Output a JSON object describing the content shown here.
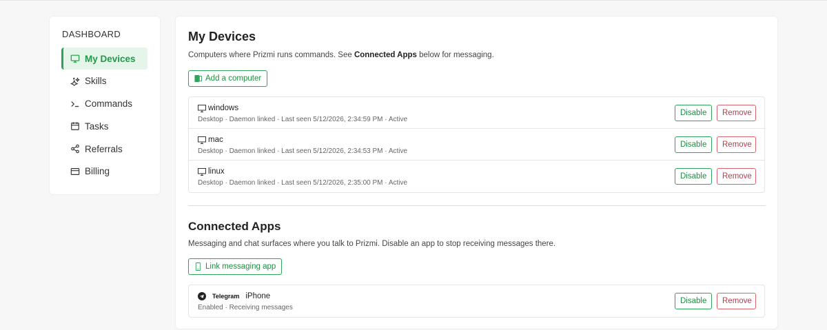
{
  "sidebar": {
    "title": "DASHBOARD",
    "items": [
      {
        "label": "My Devices",
        "icon": "monitor-icon"
      },
      {
        "label": "Skills",
        "icon": "sparkle-icon"
      },
      {
        "label": "Commands",
        "icon": "terminal-icon"
      },
      {
        "label": "Tasks",
        "icon": "calendar-icon"
      },
      {
        "label": "Referrals",
        "icon": "share-icon"
      },
      {
        "label": "Billing",
        "icon": "credit-card-icon"
      }
    ]
  },
  "devices": {
    "title": "My Devices",
    "desc_before": "Computers where Prizmi runs commands. See ",
    "desc_bold": "Connected Apps",
    "desc_after": " below for messaging.",
    "add_button": "Add a computer",
    "rows": [
      {
        "name": "windows",
        "meta": "Desktop · Daemon linked · Last seen 5/12/2026, 2:34:59 PM · Active"
      },
      {
        "name": "mac",
        "meta": "Desktop · Daemon linked · Last seen 5/12/2026, 2:34:53 PM · Active"
      },
      {
        "name": "linux",
        "meta": "Desktop · Daemon linked · Last seen 5/12/2026, 2:35:00 PM · Active"
      }
    ],
    "disable_label": "Disable",
    "remove_label": "Remove"
  },
  "apps": {
    "title": "Connected Apps",
    "desc": "Messaging and chat surfaces where you talk to Prizmi. Disable an app to stop receiving messages there.",
    "link_button": "Link messaging app",
    "rows": [
      {
        "service": "Telegram",
        "name": "iPhone",
        "meta": "Enabled · Receiving messages"
      }
    ],
    "disable_label": "Disable",
    "remove_label": "Remove"
  },
  "colors": {
    "accent_green": "#2fa35a",
    "danger_red": "#c0394a",
    "active_bg": "#e6f5ea"
  }
}
